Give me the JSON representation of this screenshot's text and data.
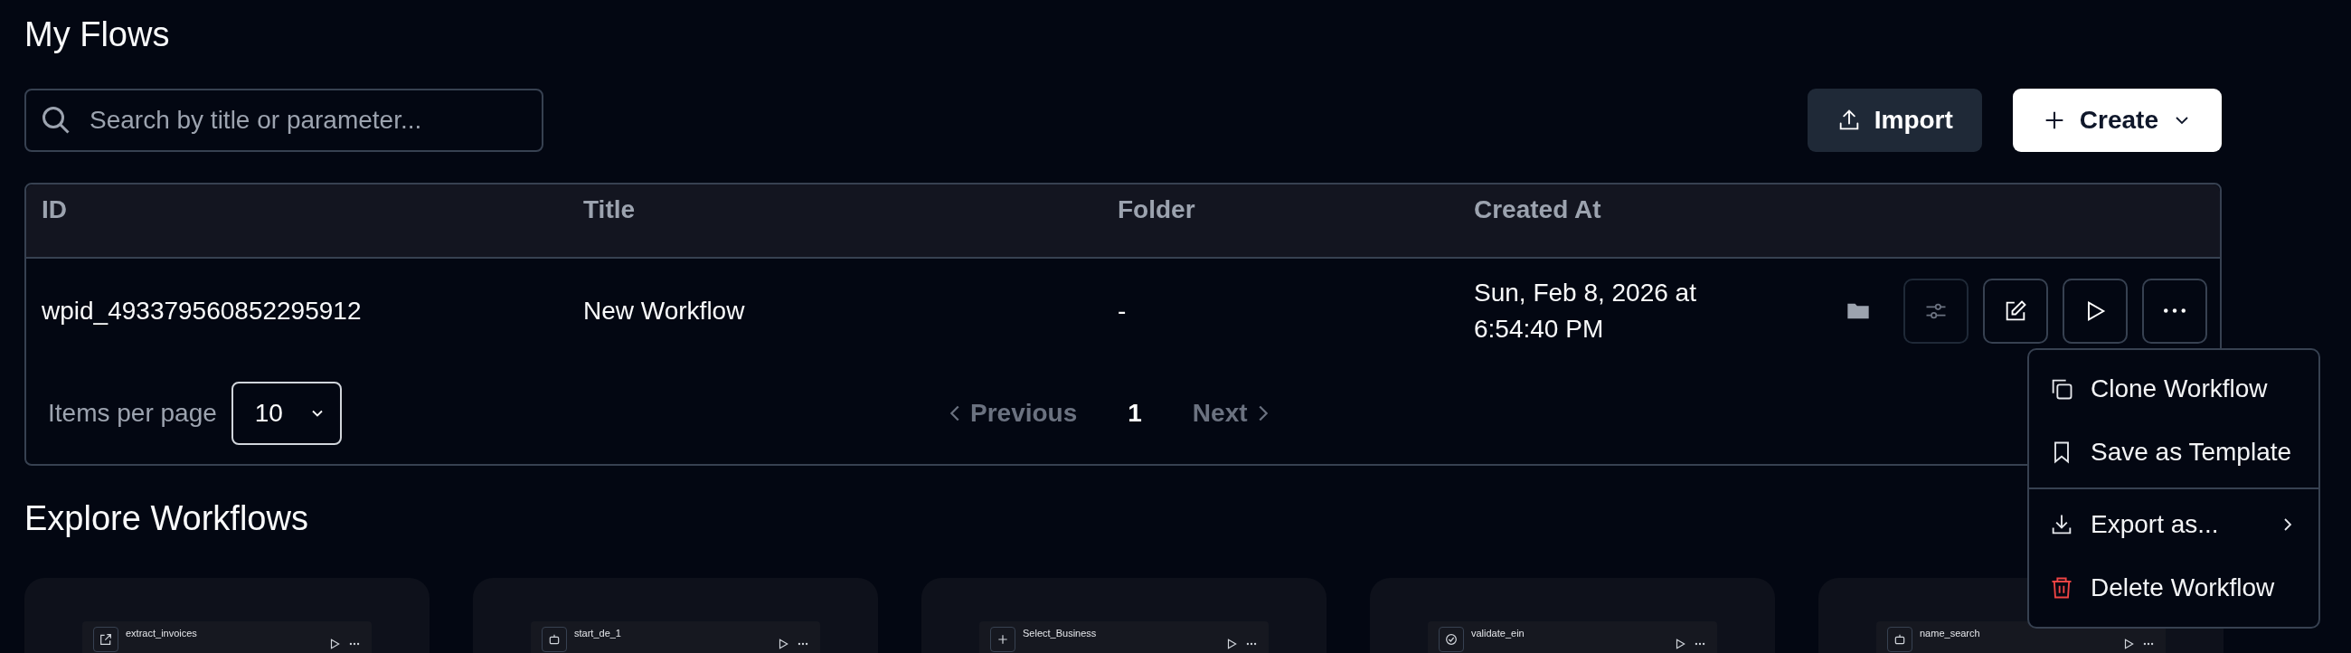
{
  "page": {
    "title": "My Flows"
  },
  "search": {
    "placeholder": "Search by title or parameter..."
  },
  "actions": [
    {
      "label": "Import",
      "kind": "import"
    },
    {
      "label": "Create",
      "kind": "create"
    }
  ],
  "table": {
    "columns": [
      "ID",
      "Title",
      "Folder",
      "Created At"
    ],
    "rows": [
      {
        "id": "wpid_493379560852295912",
        "title": "New Workflow",
        "folder": "-",
        "created_at": "Sun, Feb 8, 2026 at 6:54:40 PM"
      }
    ]
  },
  "pagination": {
    "items_per_page_label": "Items per page",
    "items_per_page": "10",
    "previous": "Previous",
    "page": "1",
    "next": "Next"
  },
  "row_menu": {
    "items": [
      {
        "label": "Clone Workflow",
        "kind": "clone"
      },
      {
        "label": "Save as Template",
        "kind": "template"
      },
      {
        "label": "Export as...",
        "kind": "export"
      },
      {
        "label": "Delete Workflow",
        "kind": "delete"
      }
    ]
  },
  "explore": {
    "title": "Explore Workflows",
    "cards": [
      {
        "node": "extract_invoices",
        "kind": "share"
      },
      {
        "node": "start_de_1",
        "kind": "robot"
      },
      {
        "node": "Select_Business",
        "kind": "plus"
      },
      {
        "node": "validate_ein",
        "kind": "check"
      },
      {
        "node": "name_search",
        "kind": "robot"
      }
    ]
  }
}
